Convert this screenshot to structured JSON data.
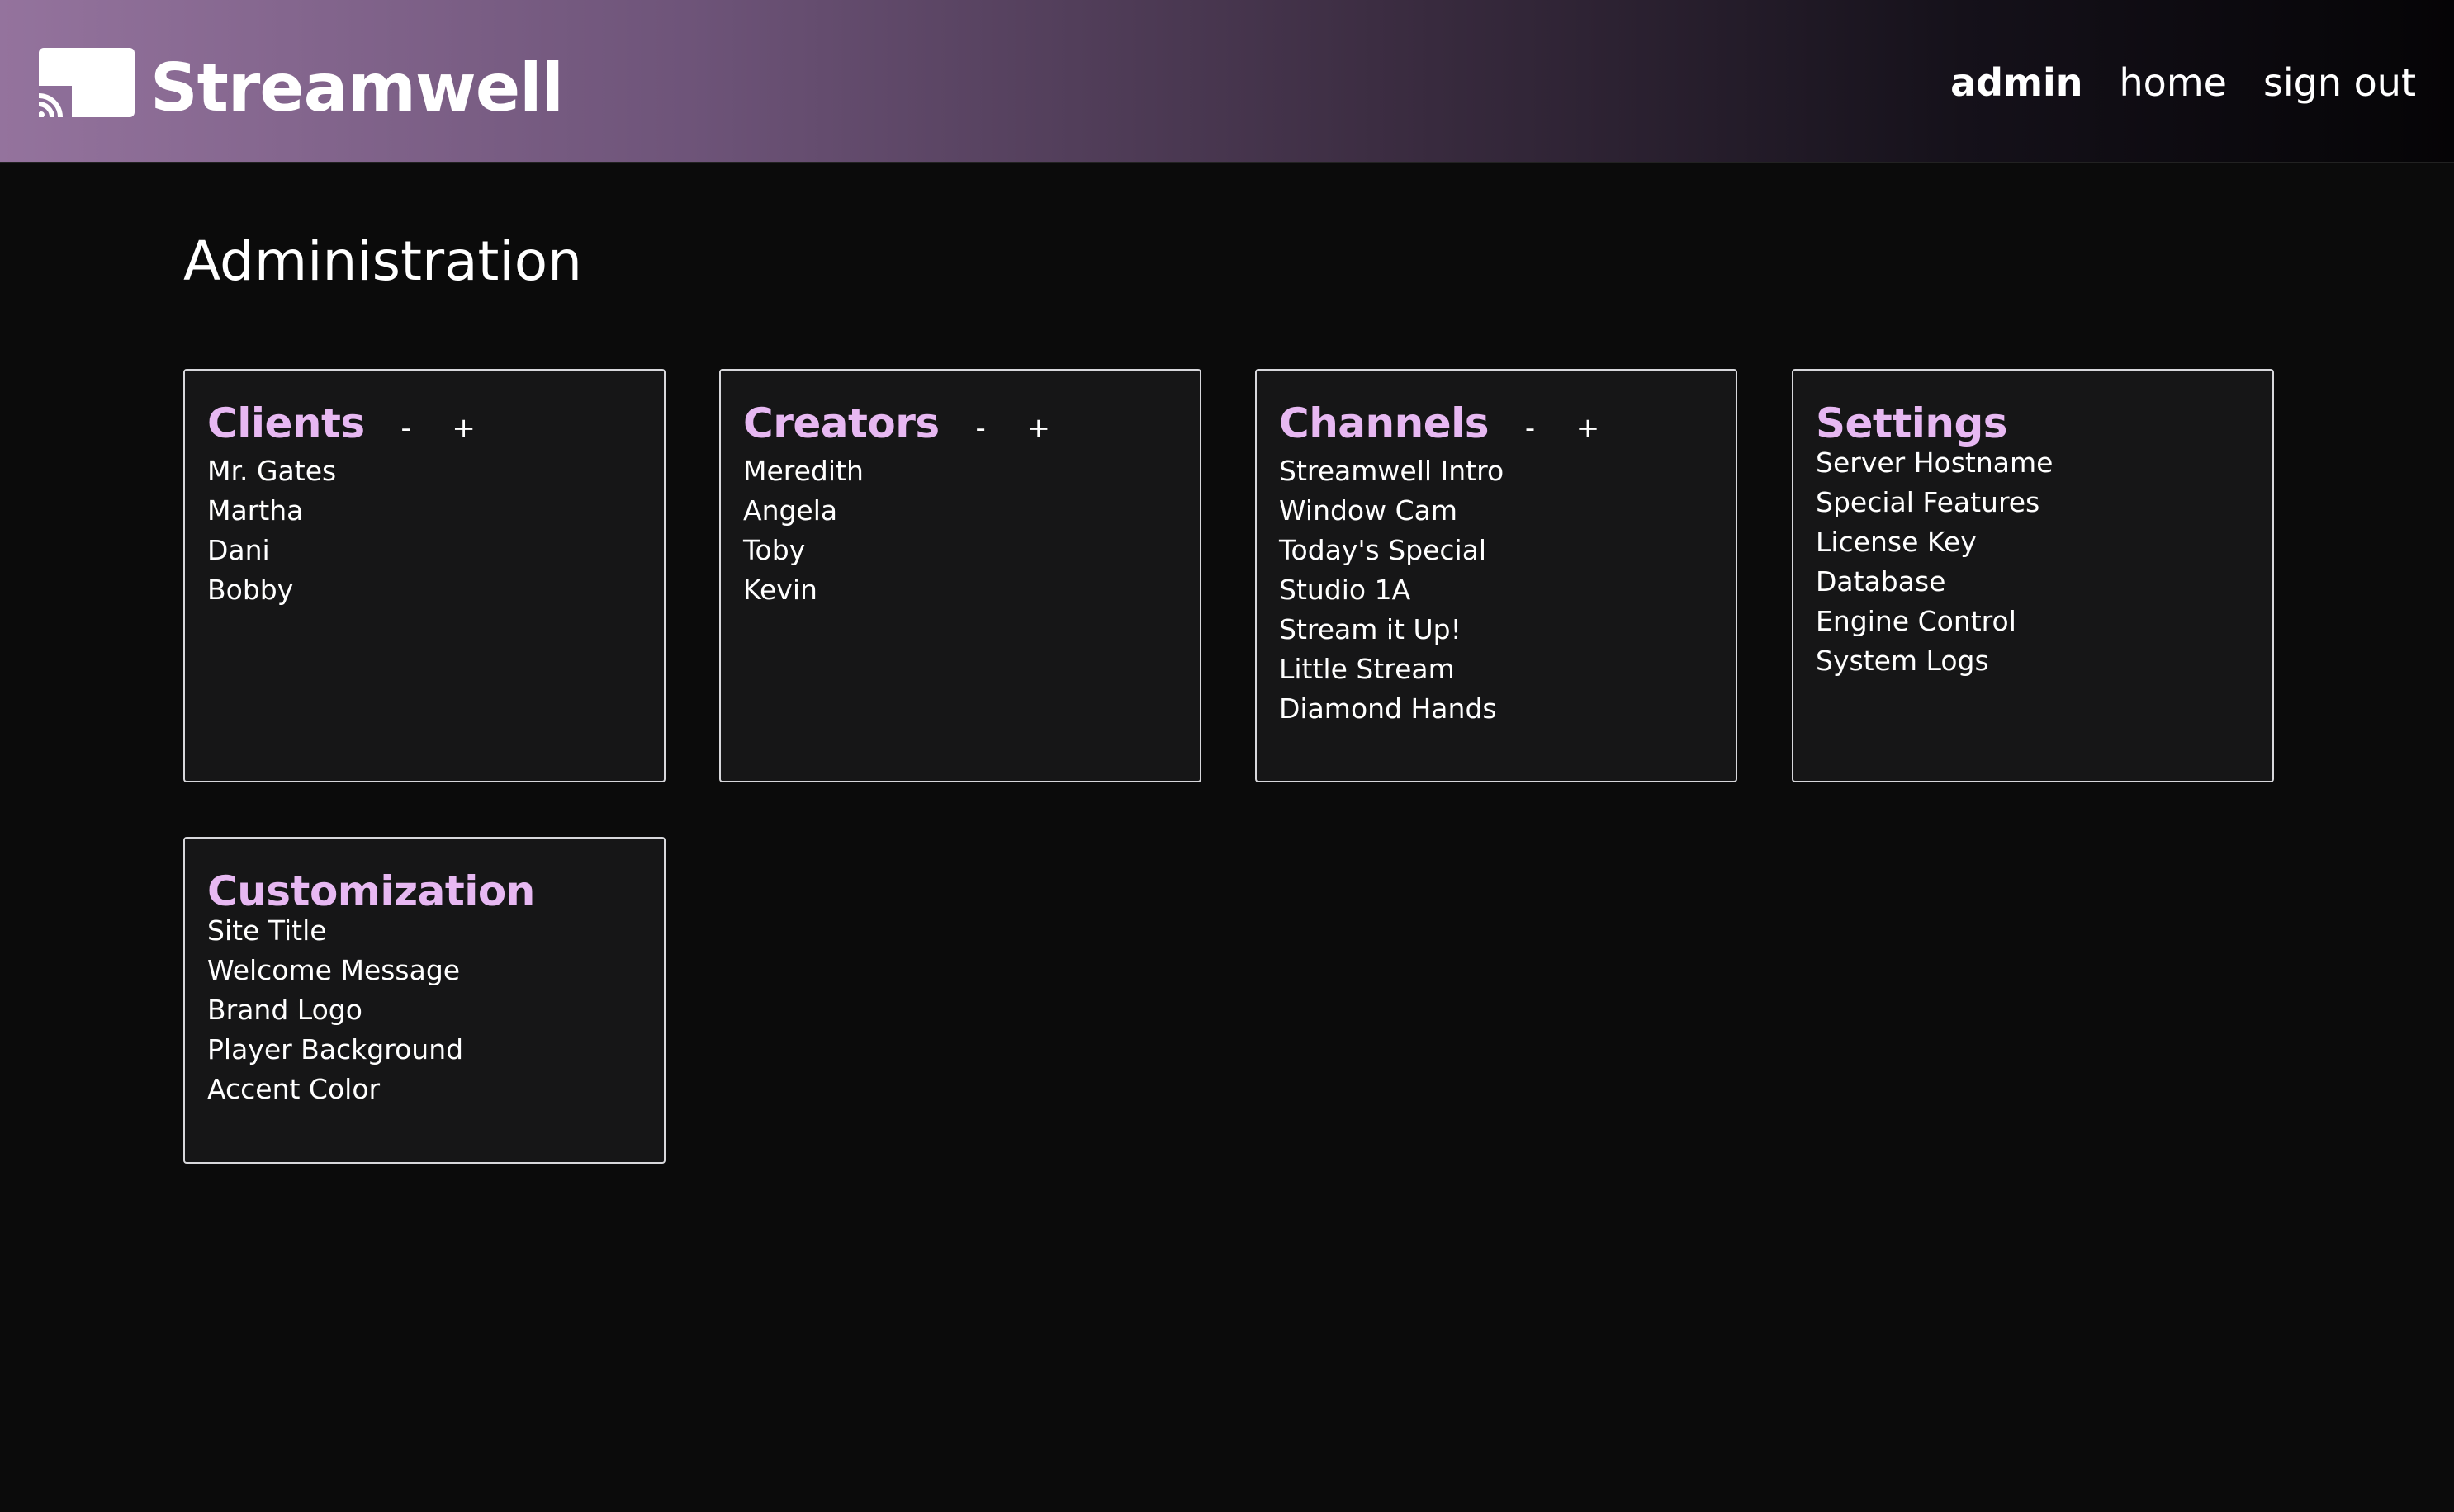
{
  "app": {
    "brand": "Streamwell",
    "logo_icon": "cast-icon",
    "accent_color": "#e7b8f2"
  },
  "nav": {
    "items": [
      {
        "label": "admin",
        "active": true
      },
      {
        "label": "home",
        "active": false
      },
      {
        "label": "sign out",
        "active": false
      }
    ]
  },
  "page": {
    "title": "Administration"
  },
  "cards": {
    "clients": {
      "title": "Clients",
      "remove_label": "-",
      "add_label": "+",
      "items": [
        "Mr. Gates",
        "Martha",
        "Dani",
        "Bobby"
      ]
    },
    "creators": {
      "title": "Creators",
      "remove_label": "-",
      "add_label": "+",
      "items": [
        "Meredith",
        "Angela",
        "Toby",
        "Kevin"
      ]
    },
    "channels": {
      "title": "Channels",
      "remove_label": "-",
      "add_label": "+",
      "items": [
        "Streamwell Intro",
        "Window Cam",
        "Today's Special",
        "Studio 1A",
        "Stream it Up!",
        "Little Stream",
        "Diamond Hands"
      ]
    },
    "settings": {
      "title": "Settings",
      "items": [
        "Server Hostname",
        "Special Features",
        "License Key",
        "Database",
        "Engine Control",
        "System Logs"
      ]
    },
    "customization": {
      "title": "Customization",
      "items": [
        "Site Title",
        "Welcome Message",
        "Brand Logo",
        "Player Background",
        "Accent Color"
      ]
    }
  }
}
